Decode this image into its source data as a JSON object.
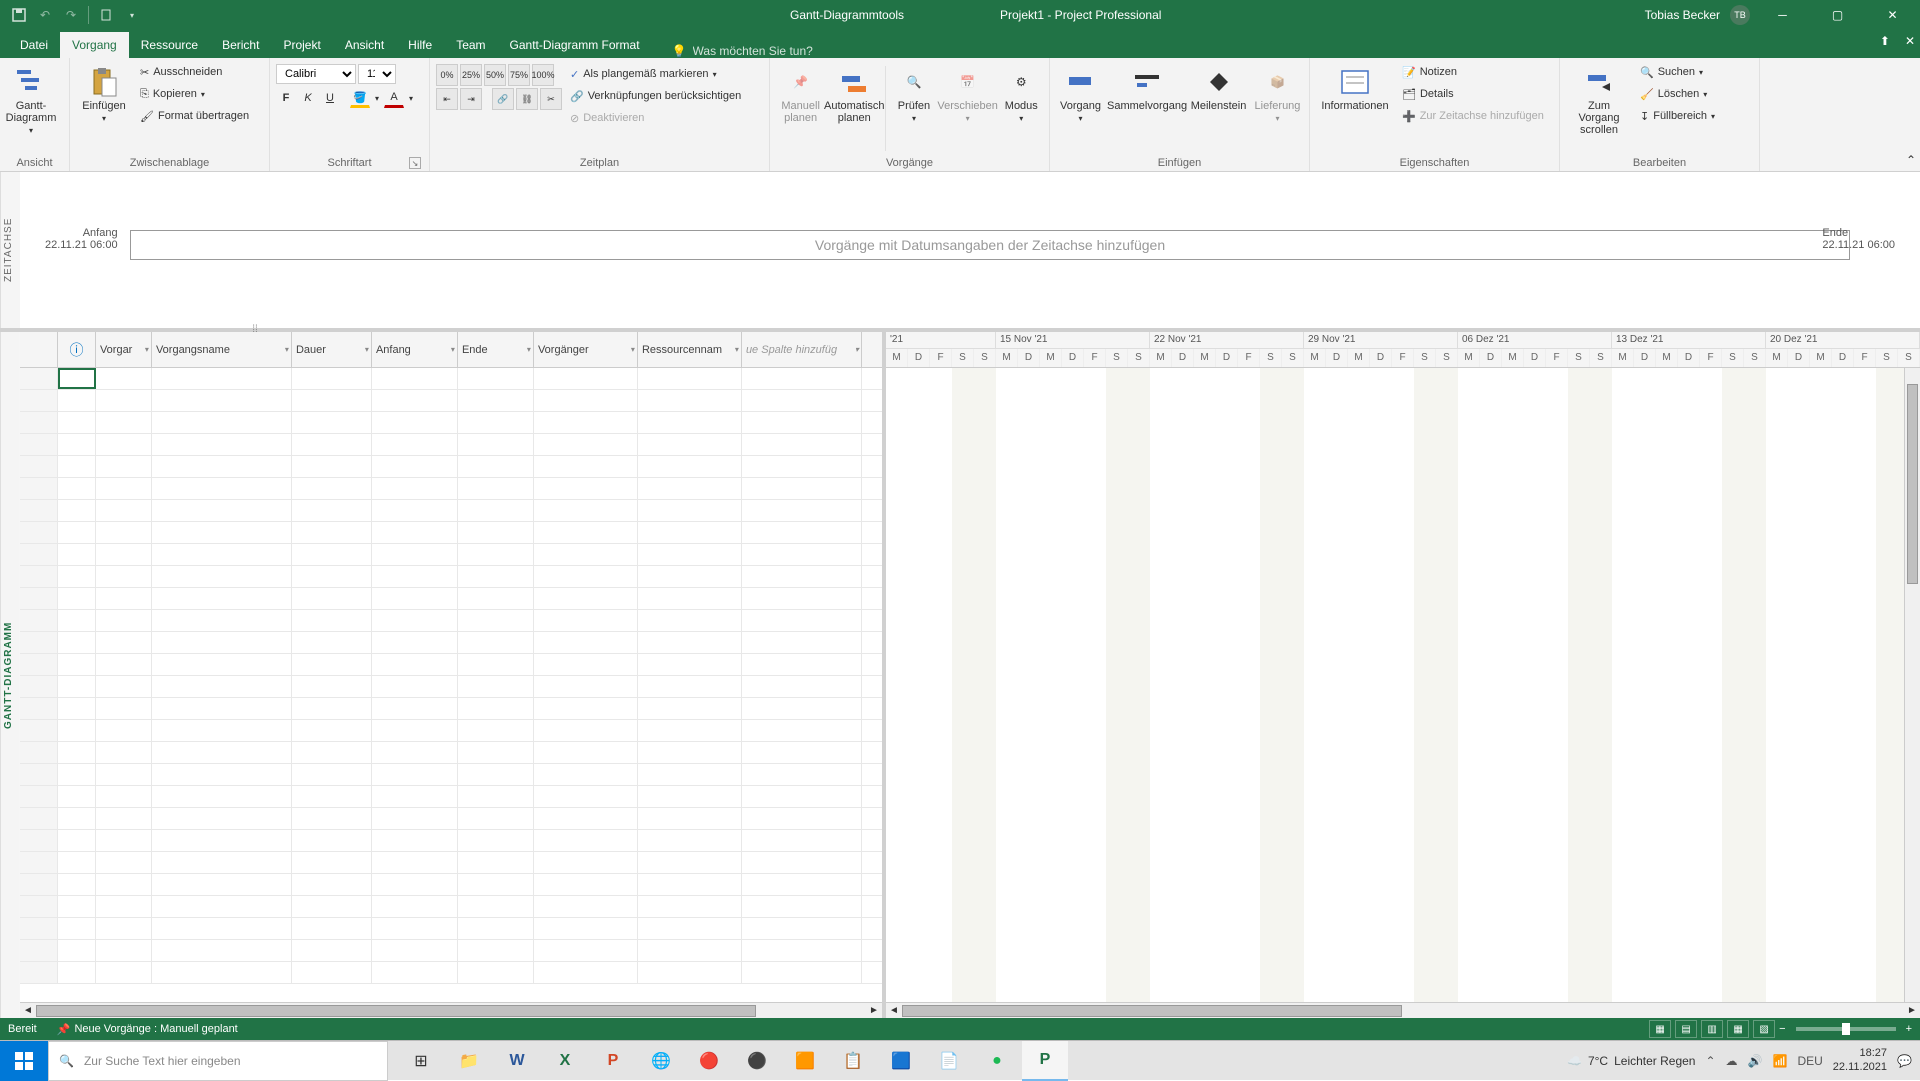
{
  "titlebar": {
    "tools_title": "Gantt-Diagrammtools",
    "doc_title": "Projekt1 - Project Professional",
    "user_name": "Tobias Becker",
    "user_initials": "TB"
  },
  "tabs": {
    "datei": "Datei",
    "vorgang": "Vorgang",
    "ressource": "Ressource",
    "bericht": "Bericht",
    "projekt": "Projekt",
    "ansicht": "Ansicht",
    "hilfe": "Hilfe",
    "team": "Team",
    "format": "Gantt-Diagramm Format",
    "tellme_placeholder": "Was möchten Sie tun?"
  },
  "ribbon": {
    "ansicht": {
      "gantt": "Gantt-\nDiagramm",
      "label": "Ansicht"
    },
    "clipboard": {
      "einfuegen": "Einfügen",
      "ausschneiden": "Ausschneiden",
      "kopieren": "Kopieren",
      "format": "Format übertragen",
      "label": "Zwischenablage"
    },
    "schriftart": {
      "font": "Calibri",
      "size": "11",
      "label": "Schriftart"
    },
    "zeitplan": {
      "als_plan": "Als plangemäß markieren",
      "verkn": "Verknüpfungen berücksichtigen",
      "deakt": "Deaktivieren",
      "label": "Zeitplan"
    },
    "vorgaenge": {
      "manuell": "Manuell\nplanen",
      "auto": "Automatisch\nplanen",
      "pruefen": "Prüfen",
      "verschieben": "Verschieben",
      "modus": "Modus",
      "label": "Vorgänge"
    },
    "einfuegen": {
      "vorgang": "Vorgang",
      "sammel": "Sammelvorgang",
      "meilenstein": "Meilenstein",
      "lieferung": "Lieferung",
      "label": "Einfügen"
    },
    "eigenschaften": {
      "info": "Informationen",
      "notizen": "Notizen",
      "details": "Details",
      "zeitachse": "Zur Zeitachse hinzufügen",
      "label": "Eigenschaften"
    },
    "bearbeiten": {
      "zum_vorgang": "Zum Vorgang\nscrollen",
      "suchen": "Suchen",
      "loeschen": "Löschen",
      "fuell": "Füllbereich",
      "label": "Bearbeiten"
    }
  },
  "timeline": {
    "vert_label": "ZEITACHSE",
    "start_label": "Anfang",
    "start_date": "22.11.21 06:00",
    "end_label": "Ende",
    "end_date": "22.11.21 06:00",
    "placeholder": "Vorgänge mit Datumsangaben der Zeitachse hinzufügen"
  },
  "grid": {
    "vert_label": "GANTT-DIAGRAMM",
    "cols": {
      "info": "ⓘ",
      "mode": "Vorgar",
      "name": "Vorgangsname",
      "dauer": "Dauer",
      "anfang": "Anfang",
      "ende": "Ende",
      "vorgaenger": "Vorgänger",
      "ressourcen": "Ressourcennam",
      "add": "ue Spalte hinzufüg"
    },
    "weeks": [
      "'21",
      "15 Nov '21",
      "22 Nov '21",
      "29 Nov '21",
      "06 Dez '21",
      "13 Dez '21",
      "20 Dez '21"
    ],
    "days": [
      "M",
      "D",
      "F",
      "S",
      "S",
      "M",
      "D",
      "M",
      "D",
      "F",
      "S",
      "S",
      "M",
      "D",
      "M",
      "D",
      "F",
      "S",
      "S",
      "M",
      "D",
      "M",
      "D",
      "F",
      "S",
      "S",
      "M",
      "D",
      "M",
      "D",
      "F",
      "S",
      "S",
      "M",
      "D",
      "M",
      "D",
      "F",
      "S",
      "S",
      "M",
      "D",
      "M",
      "D",
      "F",
      "S",
      "S"
    ]
  },
  "statusbar": {
    "ready": "Bereit",
    "new_tasks": "Neue Vorgänge : Manuell geplant"
  },
  "taskbar": {
    "search_placeholder": "Zur Suche Text hier eingeben",
    "weather_temp": "7°C",
    "weather_desc": "Leichter Regen",
    "lang": "DEU",
    "time": "18:27",
    "date": "22.11.2021"
  }
}
